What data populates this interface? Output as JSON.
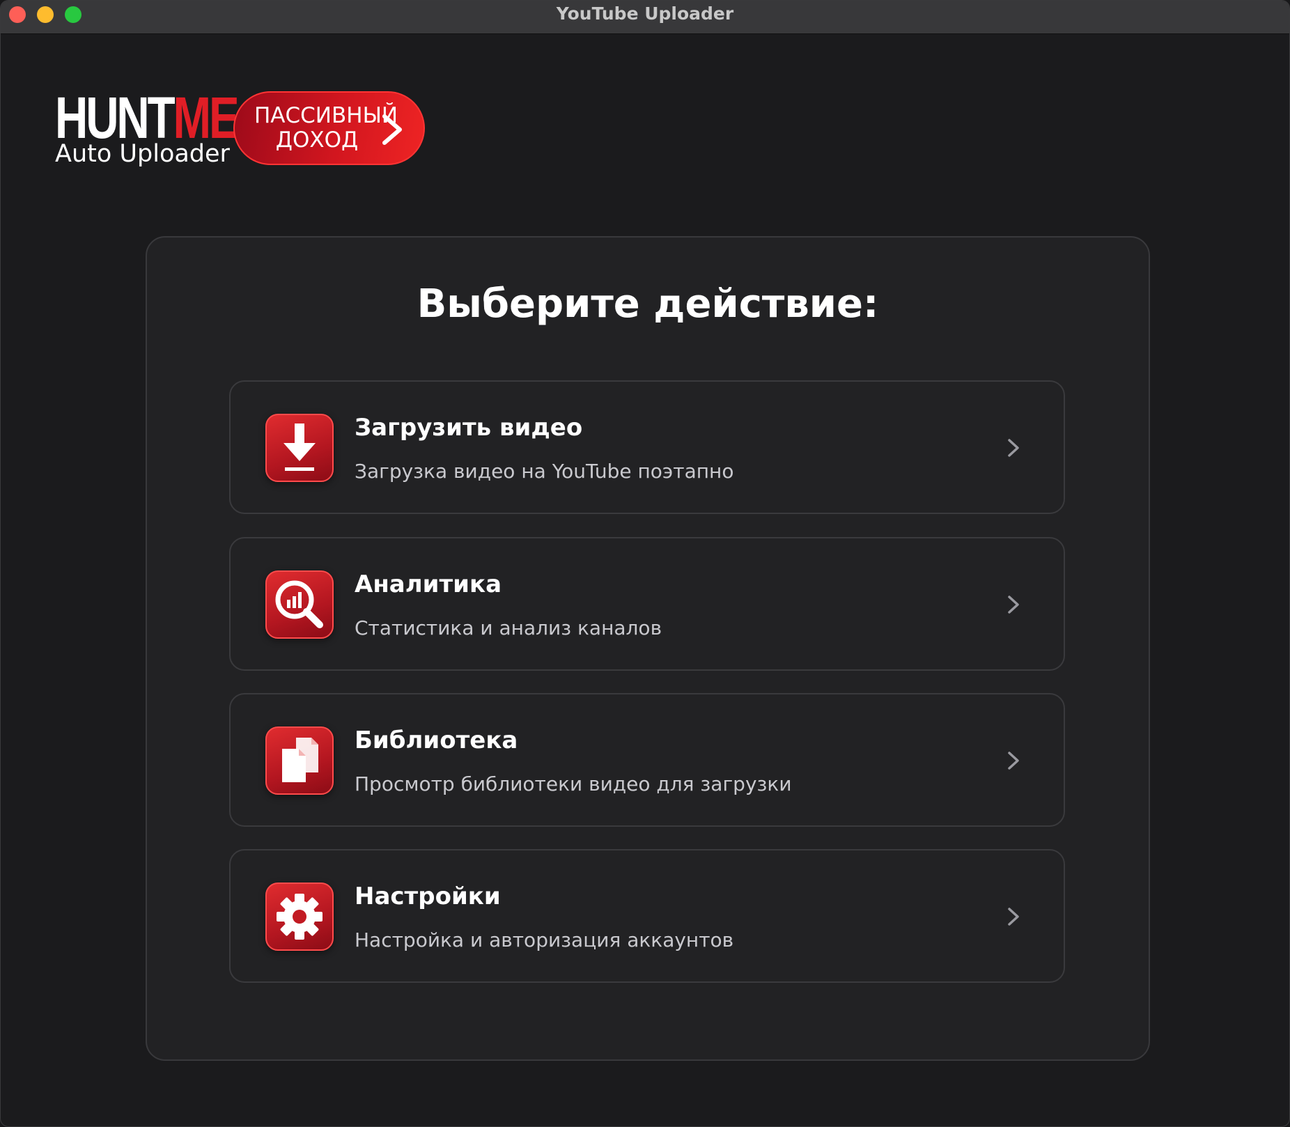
{
  "window": {
    "title": "YouTube Uploader"
  },
  "brand": {
    "logo_hunt": "HUNT",
    "logo_me": "ME",
    "subtitle": "Auto Uploader"
  },
  "promo": {
    "line1": "ПАССИВНЫЙ",
    "line2": "ДОХОД"
  },
  "panel": {
    "heading": "Выберите действие:"
  },
  "menu": [
    {
      "title": "Загрузить видео",
      "description": "Загрузка видео на YouTube поэтапно",
      "icon": "download-icon"
    },
    {
      "title": "Аналитика",
      "description": "Статистика и анализ каналов",
      "icon": "analytics-search-icon"
    },
    {
      "title": "Библиотека",
      "description": "Просмотр библиотеки видео для загрузки",
      "icon": "library-documents-icon"
    },
    {
      "title": "Настройки",
      "description": "Настройка и авторизация аккаунтов",
      "icon": "gear-icon"
    }
  ],
  "colors": {
    "accent": "#e01e26",
    "background": "#1b1b1d",
    "panel": "#222224",
    "muted_text": "#c9c9ce"
  }
}
